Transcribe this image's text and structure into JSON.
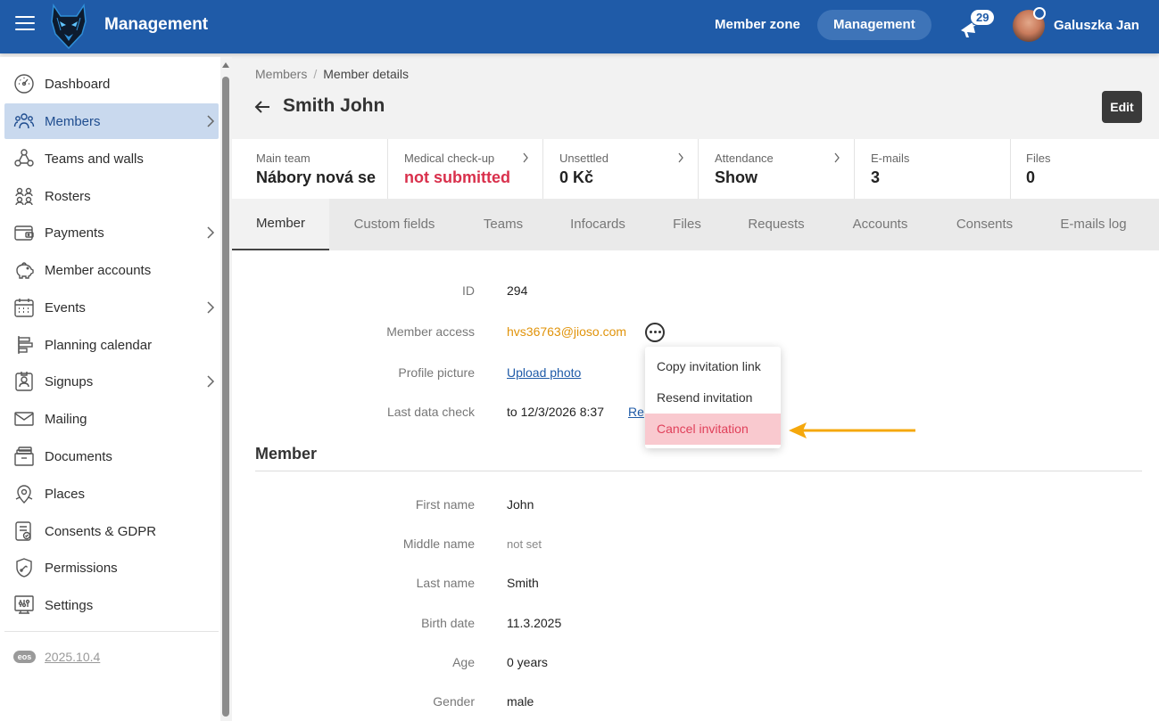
{
  "header": {
    "title": "Management",
    "nav": {
      "member_zone": "Member zone",
      "management": "Management"
    },
    "notifications_count": "29",
    "user_name": "Galuszka Jan",
    "brand_color": "#1f5ba8"
  },
  "sidebar": {
    "items": [
      {
        "label": "Dashboard",
        "icon": "dashboard-icon"
      },
      {
        "label": "Members",
        "icon": "members-icon",
        "active": true,
        "expandable": true
      },
      {
        "label": "Teams and walls",
        "icon": "teams-icon"
      },
      {
        "label": "Rosters",
        "icon": "rosters-icon"
      },
      {
        "label": "Payments",
        "icon": "payments-icon",
        "expandable": true
      },
      {
        "label": "Member accounts",
        "icon": "piggy-bank-icon"
      },
      {
        "label": "Events",
        "icon": "calendar-icon",
        "expandable": true
      },
      {
        "label": "Planning calendar",
        "icon": "planning-icon"
      },
      {
        "label": "Signups",
        "icon": "signups-icon",
        "expandable": true
      },
      {
        "label": "Mailing",
        "icon": "mail-icon"
      },
      {
        "label": "Documents",
        "icon": "documents-icon"
      },
      {
        "label": "Places",
        "icon": "places-icon"
      },
      {
        "label": "Consents & GDPR",
        "icon": "consents-icon"
      },
      {
        "label": "Permissions",
        "icon": "permissions-icon"
      },
      {
        "label": "Settings",
        "icon": "settings-icon"
      }
    ],
    "version_badge": "eos",
    "version": "2025.10.4"
  },
  "breadcrumb": {
    "parent": "Members",
    "separator": "/",
    "current": "Member details"
  },
  "page": {
    "title": "Smith John",
    "edit_label": "Edit"
  },
  "stats": [
    {
      "label": "Main team",
      "value": "Nábory nová se"
    },
    {
      "label": "Medical check-up",
      "value": "not submitted",
      "alert_color": "#d9304c"
    },
    {
      "label": "Unsettled",
      "value": "0 Kč"
    },
    {
      "label": "Attendance",
      "value": "Show"
    },
    {
      "label": "E-mails",
      "value": "3"
    },
    {
      "label": "Files",
      "value": "0"
    }
  ],
  "tabs": [
    "Member",
    "Custom fields",
    "Teams",
    "Infocards",
    "Files",
    "Requests",
    "Accounts",
    "Consents",
    "E-mails log"
  ],
  "active_tab": "Member",
  "details": {
    "id_label": "ID",
    "id_value": "294",
    "access_label": "Member access",
    "access_value": "hvs36763@jioso.com",
    "picture_label": "Profile picture",
    "picture_value": "Upload photo",
    "check_label": "Last data check",
    "check_value": "to 12/3/2026 8:37",
    "check_link": "Re"
  },
  "member_section": {
    "title": "Member",
    "fields": [
      {
        "label": "First name",
        "value": "John"
      },
      {
        "label": "Middle name",
        "value": "not set",
        "muted": true
      },
      {
        "label": "Last name",
        "value": "Smith"
      },
      {
        "label": "Birth date",
        "value": "11.3.2025"
      },
      {
        "label": "Age",
        "value": "0 years"
      },
      {
        "label": "Gender",
        "value": "male"
      }
    ]
  },
  "dropdown": {
    "items": [
      "Copy invitation link",
      "Resend invitation",
      "Cancel invitation"
    ],
    "highlighted": "Cancel invitation",
    "highlight_color": "#f9c9cf"
  },
  "annotation": {
    "arrow_color": "#f5a80c"
  }
}
